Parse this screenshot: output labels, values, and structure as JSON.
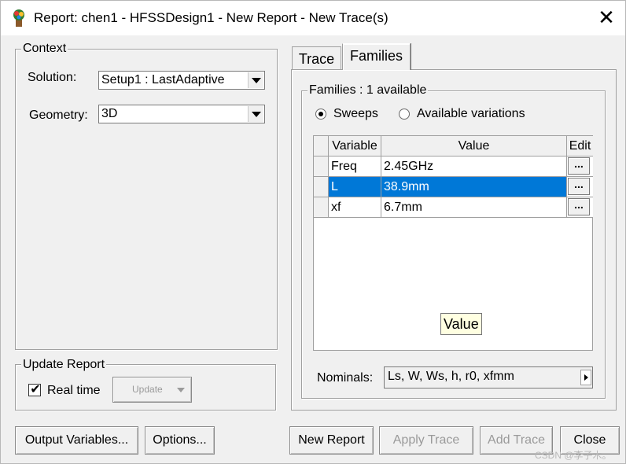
{
  "window": {
    "title": "Report: chen1 - HFSSDesign1 - New Report - New Trace(s)",
    "icon": "hfss-app-icon",
    "close_glyph": "✕"
  },
  "context": {
    "title": "Context",
    "solution_label": "Solution:",
    "solution_value": "Setup1 : LastAdaptive",
    "geometry_label": "Geometry:",
    "geometry_value": "3D"
  },
  "update_report": {
    "title": "Update Report",
    "realtime_label": "Real time",
    "realtime_checked": true,
    "update_button": "Update"
  },
  "tabs": [
    {
      "label": "Trace",
      "active": false
    },
    {
      "label": "Families",
      "active": true
    }
  ],
  "families": {
    "title": "Families : 1 available",
    "radio_sweeps": "Sweeps",
    "radio_variations": "Available variations",
    "selected_radio": "Sweeps",
    "columns": {
      "variable": "Variable",
      "value": "Value",
      "edit": "Edit"
    },
    "rows": [
      {
        "variable": "Freq",
        "value": "2.45GHz",
        "edit": "...",
        "selected": false
      },
      {
        "variable": "L",
        "value": "38.9mm",
        "edit": "...",
        "selected": true
      },
      {
        "variable": "xf",
        "value": "6.7mm",
        "edit": "...",
        "selected": false
      }
    ],
    "tooltip": "Value",
    "nominals_label": "Nominals:",
    "nominals_value": "Ls, W, Ws, h, r0, xfmm"
  },
  "buttons": {
    "output_variables": "Output Variables...",
    "options": "Options...",
    "new_report": "New Report",
    "apply_trace": "Apply Trace",
    "add_trace": "Add Trace",
    "close": "Close"
  },
  "watermark": "CSDN @李子木。",
  "colors": {
    "selection": "#0078d7",
    "window_bg": "#f0f0f0",
    "tooltip_bg": "#ffffe1"
  }
}
